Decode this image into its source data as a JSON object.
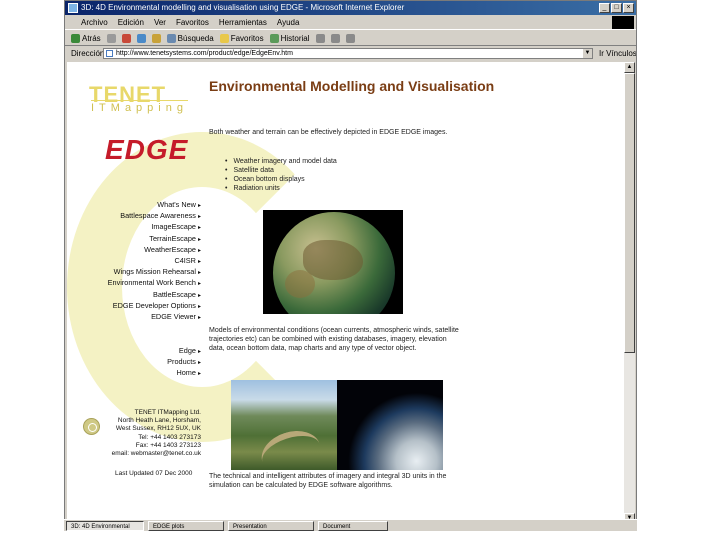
{
  "window": {
    "title": "3D: 4D Environmental modelling and visualisation using EDGE - Microsoft Internet Explorer",
    "buttons": [
      "_",
      "□",
      "×"
    ]
  },
  "menubar": {
    "items": [
      "Archivo",
      "Edición",
      "Ver",
      "Favoritos",
      "Herramientas",
      "Ayuda"
    ]
  },
  "toolbar": {
    "back": "Atrás",
    "search": "Búsqueda",
    "favorites": "Favoritos",
    "history": "Historial"
  },
  "address": {
    "label": "Dirección",
    "url": "http://www.tenetsystems.com/product/edge/EdgeEnv.htm",
    "go_label": "Ir",
    "links_label": "Vínculos »"
  },
  "page": {
    "logo_tenet": "TENET",
    "logo_itmapping": "ITMapping",
    "logo_edge": "EDGE",
    "heading": "Environmental Modelling and Visualisation",
    "intro": "Both weather and terrain can be effectively depicted in EDGE EDGE images.",
    "bullets": [
      "Weather imagery and model data",
      "Satellite data",
      "Ocean bottom displays",
      "Radiation units"
    ],
    "nav_main": [
      "What's New",
      "Battlespace Awareness",
      "ImageEscape",
      "TerrainEscape",
      "WeatherEscape",
      "C4ISR",
      "Wings Mission Rehearsal",
      "Environmental Work Bench",
      "BattleEscape",
      "EDGE Developer Options",
      "EDGE Viewer"
    ],
    "nav_secondary": [
      "Edge",
      "Products",
      "Home"
    ],
    "models_text": "Models of environmental conditions (ocean currents, atmospheric winds, satellite trajectories etc) can be combined with existing databases, imagery, elevation data, ocean bottom data, map charts and any type of vector object.",
    "company": {
      "name": "TENET ITMapping Ltd.",
      "address1": "North Heath Lane, Horsham,",
      "address2": "West Sussex, RH12 5UX, UK",
      "tel": "Tel: +44 1403 273173",
      "fax": "Fax: +44 1403 273123",
      "email": "email: webmaster@tenet.co.uk"
    },
    "updated": "Last Updated 07 Dec 2000",
    "bottom_text": "The technical and intelligent attributes of imagery and integral 3D units in the simulation can be calculated by EDGE software algorithms."
  },
  "taskbar": {
    "items": [
      "3D: 4D Environmental",
      "EDGE plots",
      "Presentation",
      "Document"
    ]
  }
}
